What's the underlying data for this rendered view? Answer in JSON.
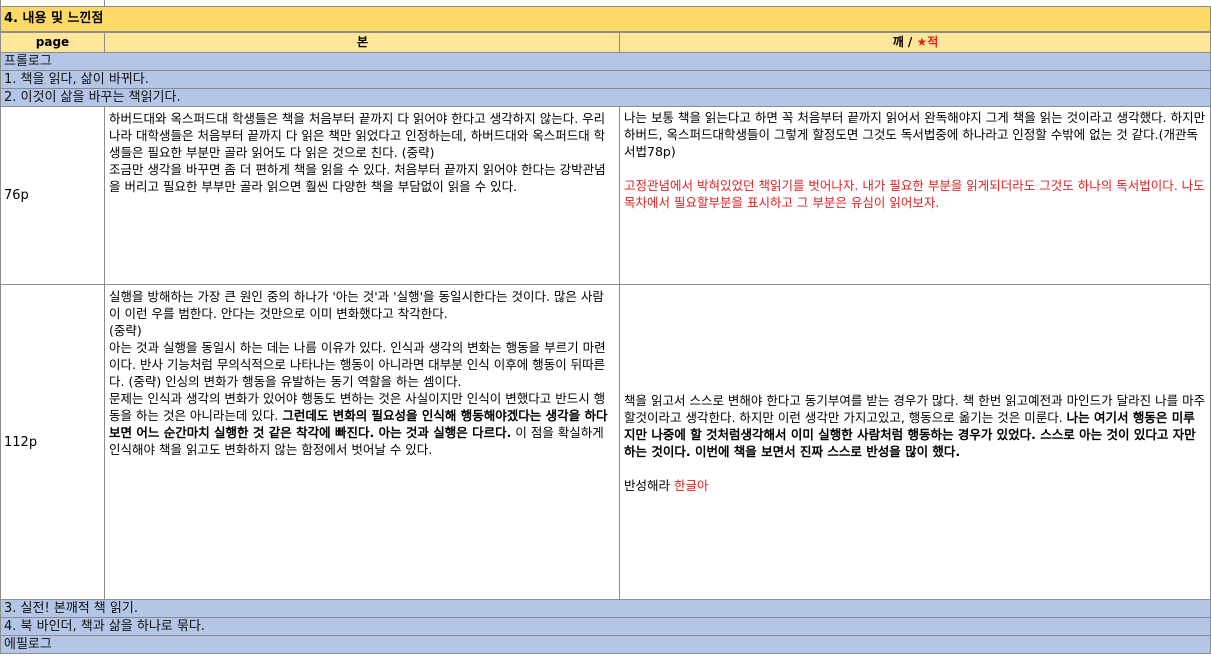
{
  "section": {
    "title": "4. 내용 및 느낀점"
  },
  "columns": {
    "page": "page",
    "bon": "본",
    "kkae": "깨 / ",
    "star": "★",
    "jeok": "적"
  },
  "chapters": [
    "프롤로그",
    "1. 책을 읽다, 삶이 바뀌다.",
    "2. 이것이 삶을 바꾸는 책읽기다.",
    "3. 실전! 본깨적 책 읽기.",
    "4. 북 바인더, 책과 삶을 하나로 묶다.",
    "에필로그"
  ],
  "entries": [
    {
      "page": "76p",
      "bon": "하버드대와 옥스퍼드대 학생들은 책을 처음부터 끝까지 다 읽어야 한다고 생각하지 않는다. 우리나라 대학생들은 처음부터 끝까지 다 읽은 책만 읽었다고 인정하는데, 하버드대와 옥스퍼드대 학생들은 필요한 부분만 골라 읽어도 다 읽은 것으로 친다. (중략)\n조금만 생각을 바꾸면 좀 더 편하게 책을 읽을 수 있다. 처음부터 끝까지 읽어야 한다는 강박관념을 버리고 필요한 부부만 골라 읽으면 훨씬 다양한 책을 부담없이 읽을 수 있다.",
      "kkae": "나는 보통 책을 읽는다고 하면 꼭 처음부터 끝까지 읽어서 완독해야지 그게 책을 읽는 것이라고 생각했다. 하지만 하버드, 옥스퍼드대학생들이 그렇게 할정도면 그것도 독서법중에 하나라고 인정할 수밖에 없는 것 같다.(개관독서법78p)",
      "jeok": "고정관념에서 박혀있었던 책읽기를 벗어나자. 내가 필요한 부분을 읽게되더라도 그것도 하나의 독서법이다. 나도 목차에서 필요할부분을 표시하고 그 부분은 유심이 읽어보자."
    },
    {
      "page": "112p",
      "bon_plain": "실행을 방해하는 가장 큰 원인 중의 하나가 '아는 것'과 '실행'을 동일시한다는 것이다. 많은 사람이 이런 우를 범한다. 안다는 것만으로 이미 변화했다고 착각한다.\n(중략)\n아는 것과 실행을 동일시 하는 데는 나름 이유가 있다. 인식과 생각의 변화는 행동을 부르기 마련이다. 반사 기능처럼 무의식적으로 나타나는 행동이 아니라면 대부분 인식 이후에 행동이 뒤따른다. (중략) 인싱의 변화가 행동을 유발하는 동기 역할을 하는 셈이다.\n문제는 인식과 생각의 변화가 있어야 행동도 변하는 것은 사실이지만 인식이 변했다고 반드시 행동을 하는 것은 아니라는데 있다. ",
      "bon_bold": "그런데도 변화의 필요성을 인식해 행동해야겠다는 생각을 하다보면 어느 순간마치 실행한 것 같은 착각에 빠진다. 아는 것과 실행은 다르다.",
      "bon_tail": " 이 점을 확실하게 인식해야 책을 읽고도 변화하지 않는 함정에서 벗어날 수 있다.",
      "kkae_plain": "책을 읽고서 스스로 변해야 한다고 동기부여를 받는 경우가 많다. 책 한번 읽고예전과 마인드가 달라진 나를 마주할것이라고 생각한다. 하지만 이런 생각만 가지고있고, 행동으로 옮기는 것은 미룬다. ",
      "kkae_bold": "나는 여기서 행동은 미루지만 나중에 할 것처럼생각해서 이미 실행한 사람처럼 행동하는 경우가 있었다. 스스로 아는 것이 있다고 자만하는 것이다. 이번에 책을 보면서 진짜 스스로 반성을 많이 했다.",
      "jeok_plain": "반성해라 ",
      "jeok_red": "한글아"
    }
  ]
}
